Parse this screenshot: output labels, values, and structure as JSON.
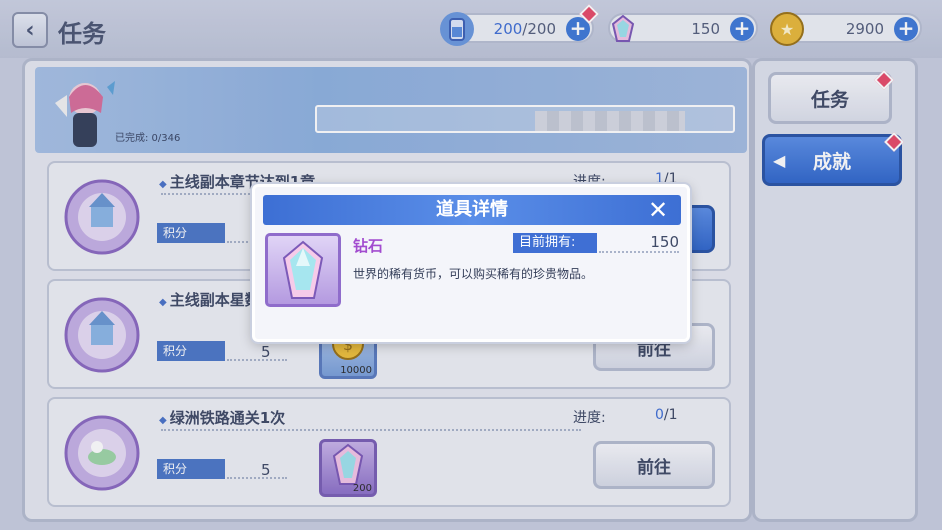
{
  "header": {
    "back_icon": "chevron-left-icon",
    "title": "任务",
    "resources": [
      {
        "icon": "energy-drink-icon",
        "current": "200",
        "sep": "/",
        "max": "200",
        "has_badge": true
      },
      {
        "icon": "diamond-icon",
        "value": "150"
      },
      {
        "icon": "gold-coin-icon",
        "value": "2900"
      }
    ]
  },
  "banner": {
    "completed_label": "已完成: 0/346"
  },
  "tasks": [
    {
      "title": "主线副本章节达到1章",
      "progress_label": "进度:",
      "progress_current": "1",
      "progress_total": "/1",
      "points_label": "积分",
      "points_value": "",
      "reward_value": "",
      "action": ""
    },
    {
      "title": "主线副本星数达",
      "progress_label": "",
      "progress_current": "",
      "progress_total": "",
      "points_label": "积分",
      "points_value": "5",
      "reward_value": "10000",
      "action": "前往"
    },
    {
      "title": "绿洲铁路通关1次",
      "progress_label": "进度:",
      "progress_current": "0",
      "progress_total": "/1",
      "points_label": "积分",
      "points_value": "5",
      "reward_value": "200",
      "action": "前往"
    }
  ],
  "sidebar": {
    "tab_task": "任务",
    "tab_achievement": "成就"
  },
  "dialog": {
    "title": "道具详情",
    "close_icon": "close-icon",
    "item_name": "钻石",
    "own_label": "目前拥有:",
    "own_value": "150",
    "description": "世界的稀有货币，可以购买稀有的珍贵物品。"
  },
  "colors": {
    "accent_blue": "#3f6fd4",
    "item_name_purple": "#a24ccf",
    "badge_red": "#e84a6a"
  }
}
